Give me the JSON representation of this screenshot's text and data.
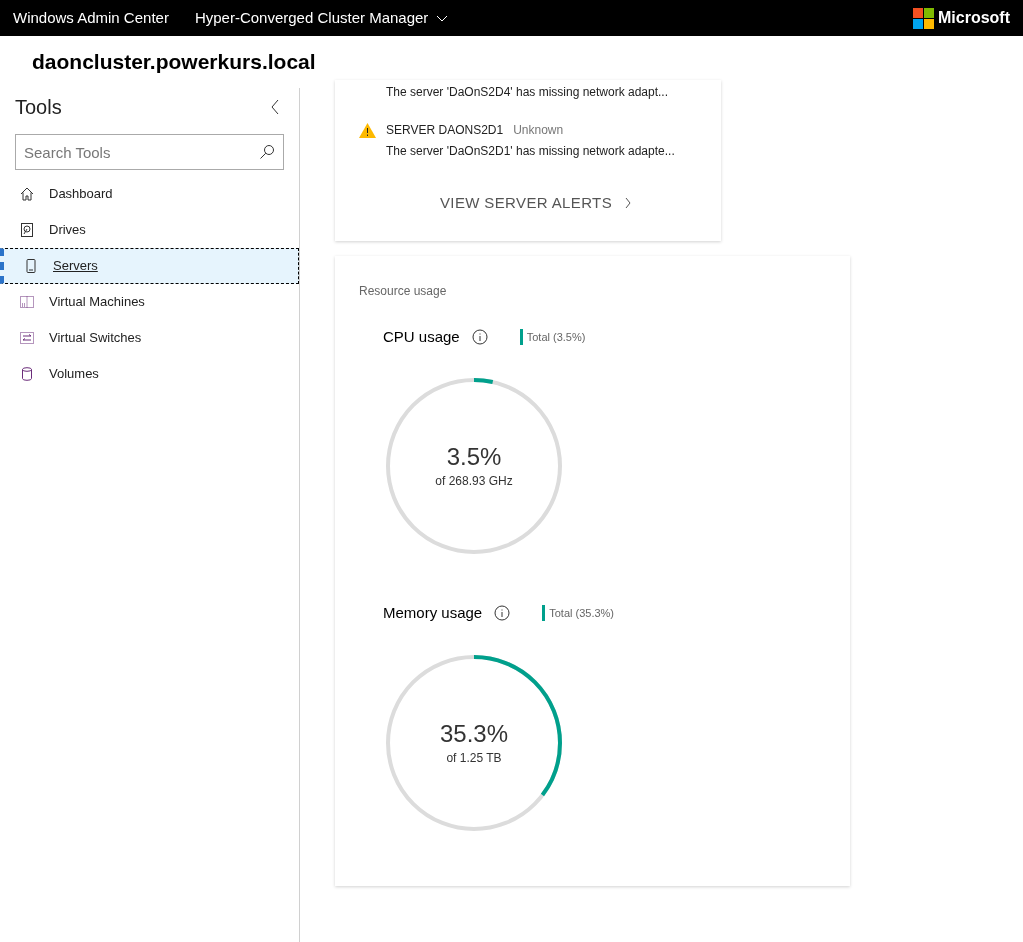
{
  "header": {
    "app_title": "Windows Admin Center",
    "tool_menu": "Hyper-Converged Cluster Manager",
    "brand": "Microsoft"
  },
  "page_title": "daoncluster.powerkurs.local",
  "sidebar": {
    "title": "Tools",
    "search": {
      "placeholder": "Search Tools"
    },
    "items": [
      {
        "label": "Dashboard",
        "kind": "home",
        "selected": false
      },
      {
        "label": "Drives",
        "kind": "drive",
        "selected": false
      },
      {
        "label": "Servers",
        "kind": "server",
        "selected": true
      },
      {
        "label": "Virtual Machines",
        "kind": "vm",
        "selected": false
      },
      {
        "label": "Virtual Switches",
        "kind": "switch",
        "selected": false
      },
      {
        "label": "Volumes",
        "kind": "volume",
        "selected": false
      }
    ]
  },
  "alerts": {
    "items": [
      {
        "message": "The server 'DaOnS2D4' has missing network adapt..."
      },
      {
        "title": "SERVER DAONS2D1",
        "status": "Unknown",
        "message": "The server 'DaOnS2D1' has missing network adapte..."
      }
    ],
    "link": "VIEW SERVER ALERTS"
  },
  "resource_usage": {
    "title": "Resource usage",
    "gauges": [
      {
        "title": "CPU usage",
        "legend": "Total (3.5%)",
        "value": "3.5%",
        "detail": "of 268.93 GHz",
        "level": 0.035
      },
      {
        "title": "Memory usage",
        "legend": "Total (35.3%)",
        "value": "35.3%",
        "detail": "of 1.25 TB",
        "level": 0.353
      }
    ]
  }
}
